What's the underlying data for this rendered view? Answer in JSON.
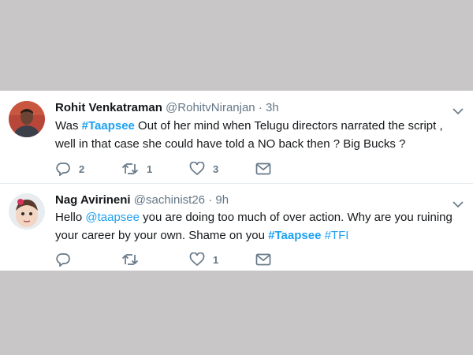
{
  "tweets": [
    {
      "name": "Rohit Venkatraman",
      "handle": "@RohitvNiranjan",
      "separator": "·",
      "time": "3h",
      "text_parts": [
        "Was ",
        "#Taapsee",
        " Out of her mind when Telugu directors narrated the script , well in that case she could have told a NO back then  ? Big Bucks ?"
      ],
      "replies": "2",
      "retweets": "1",
      "likes": "3"
    },
    {
      "name": "Nag Avirineni",
      "handle": "@sachinist26",
      "separator": "·",
      "time": "9h",
      "text_parts": [
        "Hello ",
        "@taapsee",
        " you are doing too much of over action. Why are you ruining your career by your own. Shame on you ",
        "#Taapsee",
        " ",
        "#TFI"
      ],
      "replies": "",
      "retweets": "",
      "likes": "1"
    }
  ],
  "colors": {
    "link": "#1da1f2",
    "muted": "#657786",
    "text": "#14171a",
    "backdrop": "#c8c6c7"
  },
  "icons": [
    "reply-icon",
    "retweet-icon",
    "like-icon",
    "direct-message-icon",
    "caret-down-icon"
  ]
}
